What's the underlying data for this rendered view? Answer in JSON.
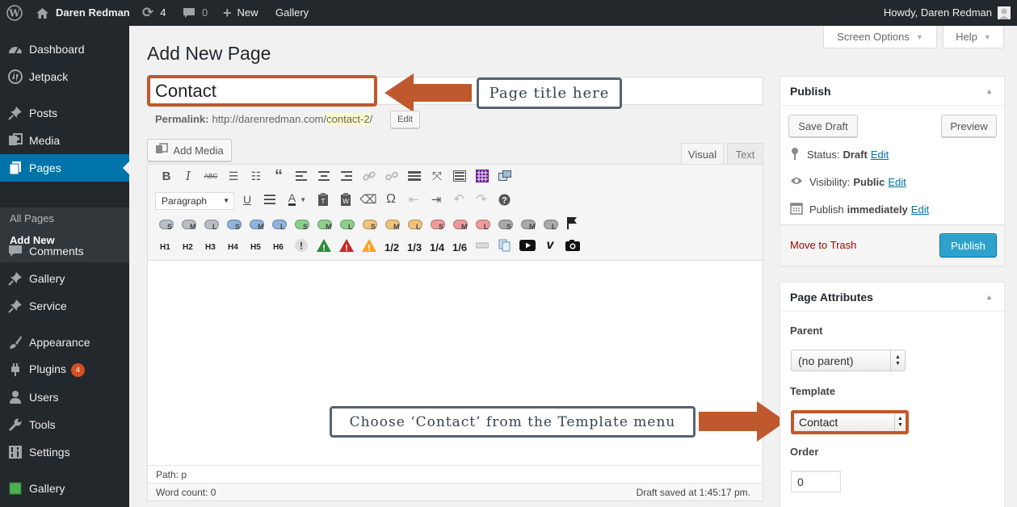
{
  "admin_bar": {
    "site_name": "Daren Redman",
    "updates_count": "4",
    "comments_count": "0",
    "new_label": "New",
    "gallery_label": "Gallery",
    "greeting": "Howdy, Daren Redman"
  },
  "sidebar": {
    "items": [
      {
        "label": "Dashboard",
        "icon": "dashboard-icon"
      },
      {
        "label": "Jetpack",
        "icon": "jetpack-icon"
      },
      {
        "label": "Posts",
        "icon": "pushpin-icon"
      },
      {
        "label": "Media",
        "icon": "media-icon"
      },
      {
        "label": "Pages",
        "icon": "pages-icon"
      },
      {
        "label": "Comments",
        "icon": "comment-icon"
      },
      {
        "label": "Gallery",
        "icon": "pushpin-icon"
      },
      {
        "label": "Service",
        "icon": "pushpin-icon"
      },
      {
        "label": "Appearance",
        "icon": "brush-icon"
      },
      {
        "label": "Plugins",
        "icon": "plugin-icon",
        "badge": "4"
      },
      {
        "label": "Users",
        "icon": "users-icon"
      },
      {
        "label": "Tools",
        "icon": "wrench-icon"
      },
      {
        "label": "Settings",
        "icon": "settings-icon"
      },
      {
        "label": "Gallery",
        "icon": "gallery-square-icon"
      }
    ],
    "pages_submenu": [
      "All Pages",
      "Add New"
    ]
  },
  "screen_meta": {
    "screen_options": "Screen Options",
    "help": "Help"
  },
  "page": {
    "heading": "Add New Page",
    "title_value": "Contact",
    "permalink_label": "Permalink:",
    "permalink_base": "http://darenredman.com/",
    "permalink_slug": "contact-2",
    "permalink_trailing": "/",
    "edit_label": "Edit"
  },
  "editor": {
    "add_media": "Add Media",
    "tab_visual": "Visual",
    "tab_text": "Text",
    "format_select": "Paragraph",
    "headings": [
      "H1",
      "H2",
      "H3",
      "H4",
      "H5",
      "H6"
    ],
    "fractions": [
      "1/2",
      "1/3",
      "1/4",
      "1/6"
    ],
    "shortcode_pills": [
      {
        "letter": "S",
        "color": "#b8bec4"
      },
      {
        "letter": "M",
        "color": "#b8bec4"
      },
      {
        "letter": "L",
        "color": "#b8bec4"
      },
      {
        "letter": "S",
        "color": "#8fb3dc"
      },
      {
        "letter": "M",
        "color": "#8fb3dc"
      },
      {
        "letter": "L",
        "color": "#8fb3dc"
      },
      {
        "letter": "S",
        "color": "#8ccf8c"
      },
      {
        "letter": "M",
        "color": "#8ccf8c"
      },
      {
        "letter": "L",
        "color": "#8ccf8c"
      },
      {
        "letter": "S",
        "color": "#f0c27a"
      },
      {
        "letter": "M",
        "color": "#f0c27a"
      },
      {
        "letter": "L",
        "color": "#f0c27a"
      },
      {
        "letter": "S",
        "color": "#ee9a9a"
      },
      {
        "letter": "M",
        "color": "#ee9a9a"
      },
      {
        "letter": "L",
        "color": "#ee9a9a"
      },
      {
        "letter": "S",
        "color": "#a9a9a9"
      },
      {
        "letter": "M",
        "color": "#a9a9a9"
      },
      {
        "letter": "L",
        "color": "#a9a9a9"
      }
    ],
    "path": "Path: p",
    "word_count": "Word count: 0",
    "draft_saved": "Draft saved at 1:45:17 pm."
  },
  "publish_box": {
    "title": "Publish",
    "save_draft": "Save Draft",
    "preview": "Preview",
    "status_label": "Status:",
    "status_value": "Draft",
    "visibility_label": "Visibility:",
    "visibility_value": "Public",
    "publish_label": "Publish",
    "publish_value": "immediately",
    "edit": "Edit",
    "trash": "Move to Trash",
    "publish_button": "Publish"
  },
  "attributes_box": {
    "title": "Page Attributes",
    "parent_label": "Parent",
    "parent_value": "(no parent)",
    "template_label": "Template",
    "template_value": "Contact",
    "order_label": "Order",
    "order_value": "0"
  },
  "annotations": {
    "title_callout": "Page title here",
    "template_callout": "Choose ‘Contact’ from the Template menu",
    "arrow_color": "#c0582d",
    "callout_border": "#56646f"
  },
  "colors": {
    "admin_bar": "#23282d",
    "accent": "#0073aa",
    "publish_button": "#2ea2cc",
    "trash": "#a00"
  }
}
